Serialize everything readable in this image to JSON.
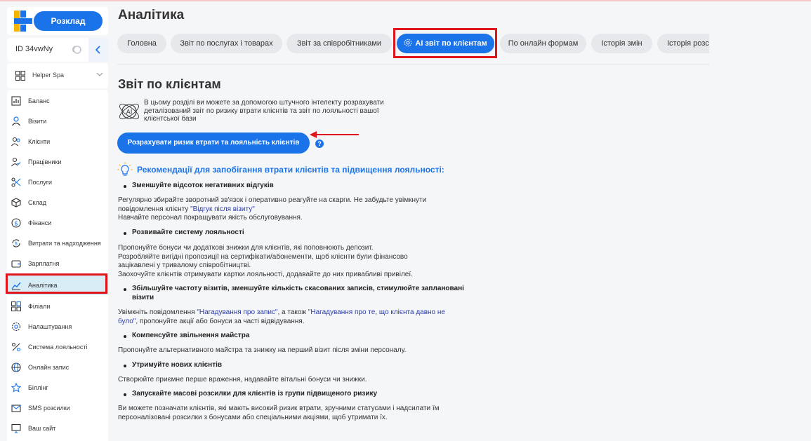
{
  "app": {
    "schedule_button": "Розклад",
    "id_label": "ID 34vwNy",
    "branch_name": "Helper Spa"
  },
  "sidebar": {
    "items": [
      {
        "label": "Баланс",
        "icon": "chart-bars-icon"
      },
      {
        "label": "Візити",
        "icon": "person-icon"
      },
      {
        "label": "Клієнти",
        "icon": "people-icon"
      },
      {
        "label": "Працівники",
        "icon": "person-check-icon"
      },
      {
        "label": "Послуги",
        "icon": "scissors-icon"
      },
      {
        "label": "Склад",
        "icon": "box-icon"
      },
      {
        "label": "Фінанси",
        "icon": "dollar-icon"
      },
      {
        "label": "Витрати та надходження",
        "icon": "money-cycle-icon"
      },
      {
        "label": "Зарплатня",
        "icon": "wallet-icon"
      },
      {
        "label": "Аналітика",
        "icon": "analytics-icon",
        "active": true
      },
      {
        "label": "Філіали",
        "icon": "grid-icon"
      },
      {
        "label": "Налаштування",
        "icon": "gear-icon"
      },
      {
        "label": "Система лояльності",
        "icon": "percent-icon"
      },
      {
        "label": "Онлайн запис",
        "icon": "globe-icon"
      },
      {
        "label": "Біллінг",
        "icon": "star-icon"
      },
      {
        "label": "SMS розсилки",
        "icon": "mail-icon"
      },
      {
        "label": "Ваш сайт",
        "icon": "monitor-icon"
      }
    ]
  },
  "page": {
    "title": "Аналітика",
    "tabs": [
      {
        "label": "Головна"
      },
      {
        "label": "Звіт по послугах і товарах"
      },
      {
        "label": "Звіт за співробітниками"
      },
      {
        "label": "AI звіт по клієнтам",
        "active": true
      },
      {
        "label": "По онлайн формам"
      },
      {
        "label": "Історія змін"
      },
      {
        "label": "Історія розс"
      }
    ]
  },
  "report": {
    "title": "Звіт по клієнтам",
    "intro": "В цьому розділі ви можете за допомогою штучного інтелекту розрахувати деталізований звіт по ризику втрати клієнтів та звіт по лояльності вашої клієнтської бази",
    "calc_button": "Розрахувати ризик втрати та лояльність клієнтів",
    "help": "?",
    "rec_title": "Рекомендації для запобігання втрати клієнтів та підвищення лояльності:",
    "recs": [
      {
        "heading": "Зменшуйте відсоток негативних відгуків",
        "l1": "Регулярно збирайте зворотний зв'язок і оперативно реагуйте на скарги. Не забудьте увімкнути",
        "l2_pre": "повідомлення клієнту ",
        "l2_link": "\"Відгук після візиту\"",
        "l3": "Навчайте персонал покращувати якість обслуговування."
      },
      {
        "heading": "Розвивайте систему лояльності",
        "l1": "Пропонуйте бонуси чи додаткові знижки для клієнтів, які поповнюють депозит.",
        "l2": "Розробляйте вигідні пропозиції на сертифікати/абонементи, щоб клієнти були фінансово",
        "l3": "зацікавлені у тривалому співробітництві.",
        "l4": "Заохочуйте клієнтів отримувати картки лояльності, додавайте до них привабливі привілеї."
      },
      {
        "heading_l1": "Збільшуйте частоту візитів, зменшуйте кількість скасованих записів, стимулюйте заплановані",
        "heading_l2": "візити",
        "l1_pre": "Увімкніть повідомлення ",
        "l1_link1": "\"Нагадування про запис\"",
        "l1_mid": ", а також ",
        "l1_link2": "\"Нагадування про те, що клієнта давно не",
        "l2_link": "було\"",
        "l2_post": ", пропонуйте акції або бонуси за часті відвідування."
      },
      {
        "heading": "Компенсуйте звільнення майстра",
        "l1": "Пропонуйте альтернативного майстра та знижку на перший візит після зміни персоналу."
      },
      {
        "heading": "Утримуйте нових клієнтів",
        "l1": "Створюйте приємне перше враження, надавайте вітальні бонуси чи знижки."
      },
      {
        "heading": "Запускайте масові розсилки для клієнтів із групи підвищеного ризику",
        "l1": "Ви можете позначати клієнтів, які мають високий ризик втрати, зручними статусами і надсилати їм",
        "l2": "персоналізовані розсилки з бонусами або спеціальними акціями, щоб утримати їх."
      }
    ]
  },
  "colors": {
    "accent": "#1a73e8",
    "highlight": "#e0141b",
    "active_menu_bg": "#d8ecf6"
  }
}
